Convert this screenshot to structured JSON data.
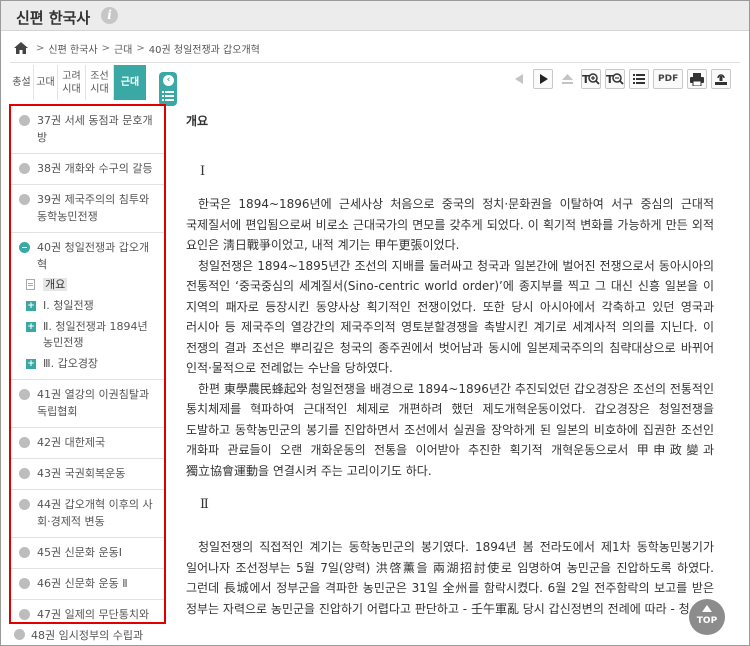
{
  "header": {
    "title": "신편 한국사"
  },
  "breadcrumb": [
    "신편 한국사",
    "근대",
    "40권 청일전쟁과 갑오개혁"
  ],
  "tabs": [
    "총설",
    "고대",
    "고려시대",
    "조선시대",
    "근대"
  ],
  "toolbar": {
    "pdf_label": "PDF"
  },
  "sidebar": {
    "items": [
      {
        "label": "37권 서세 동점과 문호개방"
      },
      {
        "label": "38권 개화와 수구의 갈등"
      },
      {
        "label": "39권 제국주의의 침투와 동학농민전쟁"
      },
      {
        "label": "40권 청일전쟁과 갑오개혁"
      },
      {
        "label": "41권 열강의 이권침탈과 독립협회"
      },
      {
        "label": "42권 대한제국"
      },
      {
        "label": "43권 국권회복운동"
      },
      {
        "label": "44권 갑오개혁 이후의 사회·경제적 변동"
      },
      {
        "label": "45권 신문화 운동Ⅰ"
      },
      {
        "label": "46권 신문화 운동 Ⅱ"
      },
      {
        "label": "47권 일제의 무단통치와 3·1운동"
      },
      {
        "label": "48권 임시정부의 수립과"
      }
    ],
    "sub_items": [
      {
        "label": "개요"
      },
      {
        "label": "Ⅰ. 청일전쟁"
      },
      {
        "label": "Ⅱ. 청일전쟁과 1894년 농민전쟁"
      },
      {
        "label": "Ⅲ. 갑오경장"
      }
    ]
  },
  "content": {
    "title": "개요",
    "section1": "Ⅰ",
    "p1": "한국은 1894~1896년에 근세사상 처음으로 중국의 정치·문화권을 이탈하여 서구 중심의 근대적 국제질서에 편입됨으로써 비로소 근대국가의 면모를 갖추게 되었다. 이 획기적 변화를 가능하게 만든 외적 요인은 淸日戰爭이었고, 내적 계기는 甲午更張이었다.",
    "p2": "청일전쟁은 1894~1895년간 조선의 지배를 둘러싸고 청국과 일본간에 벌어진 전쟁으로서 동아시아의 전통적인 ‘중국중심의 세계질서(Sino-centric world order)’에 종지부를 찍고 그 대신 신흥 일본을 이 지역의 패자로 등장시킨 동양사상 획기적인 전쟁이었다. 또한 당시 아시아에서 각축하고 있던 영국과 러시아 등 제국주의 열강간의 제국주의적 영토분할경쟁을 촉발시킨 계기로 세계사적 의의를 지닌다. 이 전쟁의 결과 조선은 뿌리깊은 청국의 종주권에서 벗어남과 동시에 일본제국주의의 침략대상으로 바뀌어 인적·물적으로 전례없는 수난을 당하였다.",
    "p3": "한편 東學農民蜂起와 청일전쟁을 배경으로 1894~1896년간 추진되었던 갑오경장은 조선의 전통적인 통치체제를 혁파하여 근대적인 체제로 개편하려 했던 제도개혁운동이었다. 갑오경장은 청일전쟁을 도발하고 동학농민군의 봉기를 진압하면서 조선에서 실권을 장악하게 된 일본의 비호하에 집권한 조선인 개화파 관료들이 오랜 개화운동의 전통을 이어받아 추진한 획기적 개혁운동으로서 甲申政變과 獨立協會運動을 연결시켜 주는 고리이기도 하다.",
    "section2": "Ⅱ",
    "p4": "청일전쟁의 직접적인 계기는 동학농민군의 봉기였다. 1894년 봄 전라도에서 제1차 동학농민봉기가 일어나자 조선정부는 5월 7일(양력) 洪啓薰을 兩湖招討使로 임명하여 농민군을 진압하도록 하였다. 그런데 長城에서 정부군을 격파한 농민군은 31일 全州를 함락시켰다. 6월 2일 전주함락의 보고를 받은 정부는 자력으로 농민군을 진압하기 어렵다고 판단하고 - 壬午軍亂 당시 갑신정변의 전례에 따라 - 청"
  },
  "top_button": {
    "label": "TOP"
  }
}
